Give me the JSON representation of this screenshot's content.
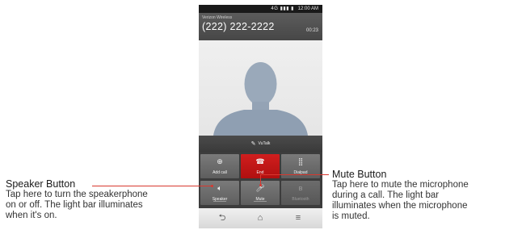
{
  "statusbar": {
    "icons": "4G ▮▮▮ ▮",
    "time": "12:00 AM"
  },
  "call": {
    "carrier": "Verizon Wireless",
    "number": "(222) 222-2222",
    "timer": "00:23"
  },
  "vutalk": {
    "icon": "vutalk-icon",
    "label": "VuTalk"
  },
  "buttons": [
    {
      "label": "Add call",
      "icon": "⊕",
      "icon_name": "add-call-icon"
    },
    {
      "label": "End",
      "icon": "☎",
      "icon_name": "end-call-icon"
    },
    {
      "label": "Dialpad",
      "icon": "⣿",
      "icon_name": "dialpad-icon"
    },
    {
      "label": "Speaker",
      "icon": "🔈︎",
      "icon_name": "speaker-icon"
    },
    {
      "label": "Mute",
      "icon": "🎤︎",
      "icon_name": "microphone-icon"
    },
    {
      "label": "Bluetooth",
      "icon": "ʙ",
      "icon_name": "bluetooth-icon"
    }
  ],
  "navbar": {
    "back": "⮌",
    "home": "⌂",
    "menu": "≡"
  },
  "callouts": {
    "speaker": {
      "title": "Speaker Button",
      "lines": [
        "Tap here to turn the speakerphone",
        "on or off. The light bar illuminates",
        "when it's on."
      ]
    },
    "mute": {
      "title": "Mute Button",
      "lines": [
        "Tap here to mute the microphone",
        "during a call. The light bar",
        "illuminates when the microphone",
        "is muted."
      ]
    }
  },
  "colors": {
    "accent": "#d8382f",
    "end_button": "#c81818",
    "header": "#505050",
    "control_bg": "#3c3c3c"
  }
}
